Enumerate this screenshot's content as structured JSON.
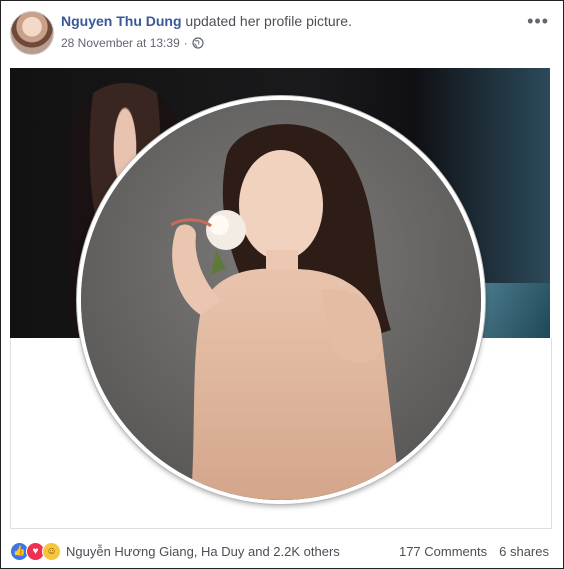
{
  "post": {
    "author": "Nguyen Thu Dung",
    "action": " updated her profile picture.",
    "timestamp": "28 November at 13:39",
    "separator": "·",
    "privacy_icon": "globe-icon",
    "menu_icon": "more-options-icon"
  },
  "reactions": {
    "icons": [
      "like-icon",
      "love-icon",
      "haha-icon"
    ],
    "text": "Nguyễn Hương Giang, Ha Duy and 2.2K others"
  },
  "stats": {
    "comments": "177 Comments",
    "shares": "6 shares"
  },
  "colors": {
    "link": "#385898",
    "like": "#3b77e8",
    "love": "#f0304f",
    "haha": "#f7c63c"
  }
}
